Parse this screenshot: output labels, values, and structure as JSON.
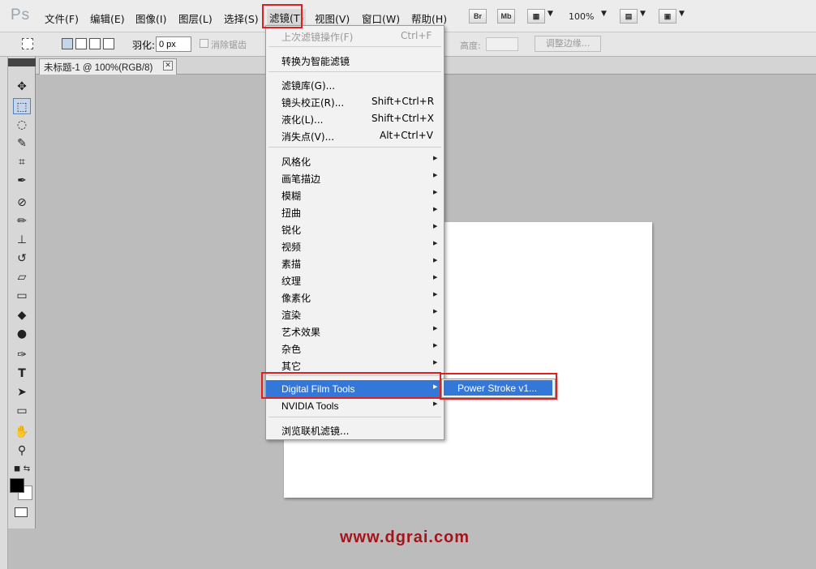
{
  "app": {
    "logo": "Ps",
    "zoom": "100%",
    "bridge_label": "Br",
    "minibridge_label": "Mb"
  },
  "menubar": {
    "items": [
      "文件(F)",
      "编辑(E)",
      "图像(I)",
      "图层(L)",
      "选择(S)",
      "滤镜(T)",
      "视图(V)",
      "窗口(W)",
      "帮助(H)"
    ]
  },
  "options_bar": {
    "feather_label": "羽化:",
    "feather_value": "0 px",
    "antialias_label": "消除锯齿",
    "height_label": "高度:",
    "refine_edge_label": "调整边缘..."
  },
  "document": {
    "tab_title": "未标题-1 @ 100%(RGB/8)",
    "close_glyph": "✕"
  },
  "filter_menu": {
    "last_filter": {
      "label": "上次滤镜操作(F)",
      "shortcut": "Ctrl+F",
      "disabled": true
    },
    "smart_filters": "转换为智能滤镜",
    "group1": [
      {
        "label": "滤镜库(G)...",
        "shortcut": ""
      },
      {
        "label": "镜头校正(R)...",
        "shortcut": "Shift+Ctrl+R"
      },
      {
        "label": "液化(L)...",
        "shortcut": "Shift+Ctrl+X"
      },
      {
        "label": "消失点(V)...",
        "shortcut": "Alt+Ctrl+V"
      }
    ],
    "submenus": [
      "风格化",
      "画笔描边",
      "模糊",
      "扭曲",
      "锐化",
      "视频",
      "素描",
      "纹理",
      "像素化",
      "渲染",
      "艺术效果",
      "杂色",
      "其它"
    ],
    "plugins": [
      "Digital Film Tools",
      "NVIDIA Tools"
    ],
    "browse_online": "浏览联机滤镜..."
  },
  "submenu": {
    "item": "Power Stroke v1..."
  },
  "tools": [
    "move-icon",
    "marquee-icon",
    "lasso-icon",
    "quick-select-icon",
    "crop-icon",
    "eyedropper-icon",
    "healing-brush-icon",
    "brush-icon",
    "clone-stamp-icon",
    "history-brush-icon",
    "eraser-icon",
    "gradient-icon",
    "blur-icon",
    "dodge-icon",
    "pen-icon",
    "type-icon",
    "path-select-icon",
    "shape-icon",
    "hand-icon",
    "zoom-icon"
  ],
  "colors": {
    "highlight": "#3378d8",
    "annotation": "#e02020",
    "watermark": "#a4151b"
  },
  "watermark": "www.dgrai.com"
}
